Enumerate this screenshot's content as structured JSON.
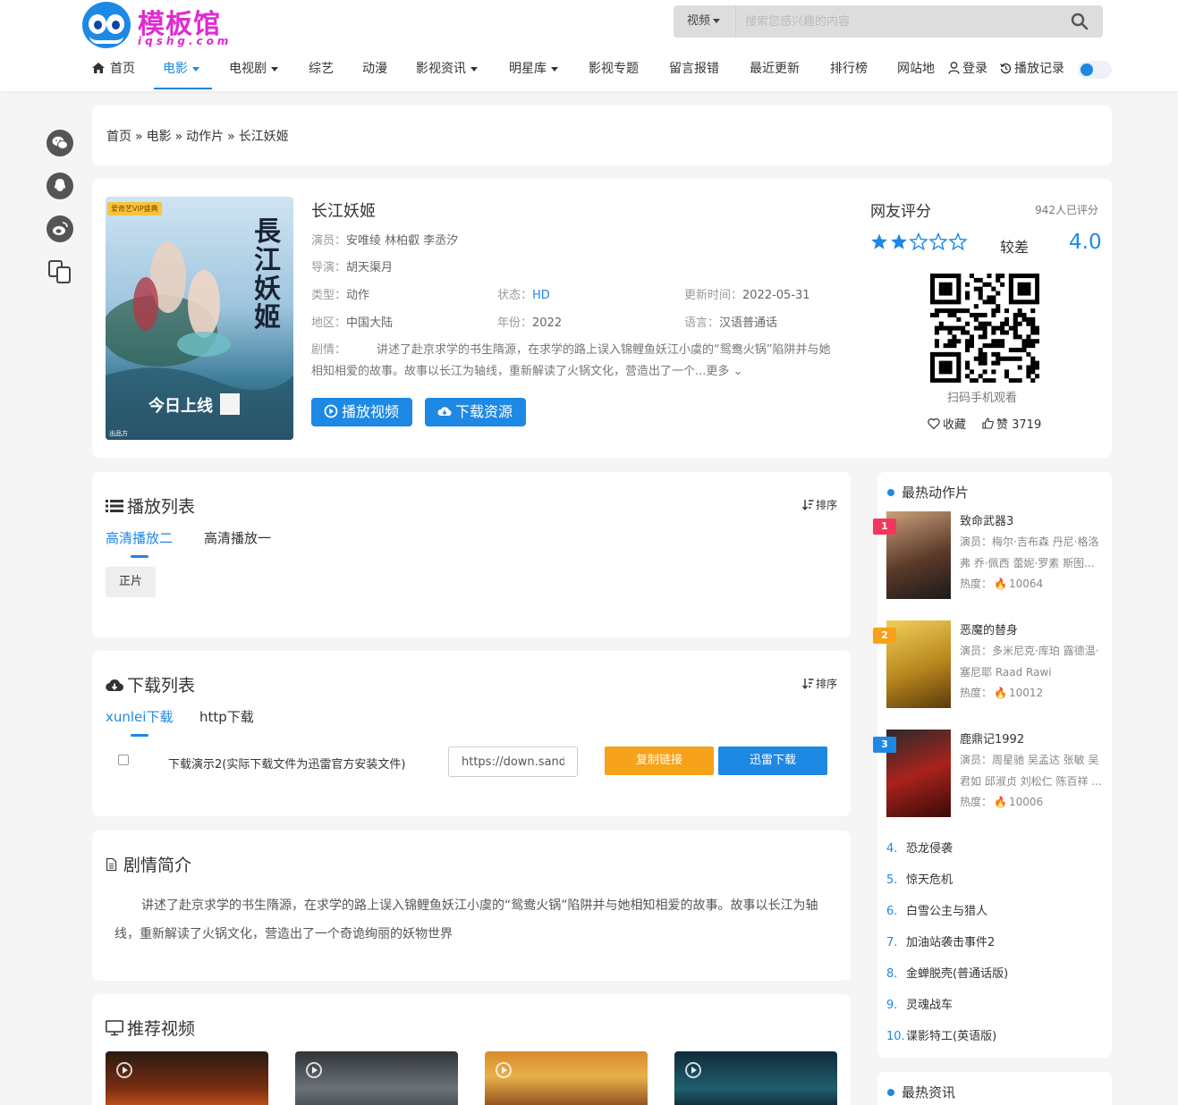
{
  "logo": {
    "text": "模板馆",
    "sub": "iqshg.com"
  },
  "search": {
    "type": "视频",
    "placeholder": "搜索您感兴趣的内容"
  },
  "nav": {
    "items": [
      {
        "label": "首页",
        "icon": "home-icon"
      },
      {
        "label": "电影",
        "active": true,
        "dropdown": true
      },
      {
        "label": "电视剧",
        "dropdown": true
      },
      {
        "label": "综艺"
      },
      {
        "label": "动漫"
      },
      {
        "label": "影视资讯",
        "dropdown": true
      },
      {
        "label": "明星库",
        "dropdown": true
      },
      {
        "label": "影视专题"
      },
      {
        "label": "留言报错"
      },
      {
        "label": "最近更新"
      },
      {
        "label": "排行榜"
      },
      {
        "label": "网站地图"
      }
    ],
    "login": "登录",
    "history": "播放记录"
  },
  "share": [
    "wechat-icon",
    "qq-icon",
    "weibo-icon",
    "copy-icon"
  ],
  "breadcrumb": {
    "home": "首页",
    "cat": "电影",
    "sub": "动作片",
    "current": "长江妖姬",
    "sep": "»"
  },
  "movie": {
    "title": "长江妖姬",
    "poster": {
      "tag": "爱奇艺VIP盛典",
      "title": "長江妖姬",
      "bottom": "今日上线",
      "foot": "出品方"
    },
    "actors_label": "演员：",
    "actors": "安唯绫 林柏叡 李丞汐",
    "director_label": "导演：",
    "director": "胡天渠月",
    "type_label": "类型：",
    "type": "动作",
    "status_label": "状态：",
    "status": "HD",
    "updated_label": "更新时间：",
    "updated": "2022-05-31",
    "area_label": "地区：",
    "area": "中国大陆",
    "year_label": "年份：",
    "year": "2022",
    "lang_label": "语言：",
    "lang": "汉语普通话",
    "plot_label": "剧情：",
    "plot_short": "讲述了赴京求学的书生隋源，在求学的路上误入锦鲤鱼妖江小虞的“鸳鸯火锅”陷阱并与她相知相爱的故事。故事以长江为轴线，重新解读了火锅文化，营造出了一个...",
    "more": "更多",
    "play_btn": "播放视频",
    "download_btn": "下载资源"
  },
  "rating": {
    "title": "网友评分",
    "count": "942人已评分",
    "stars_filled": 2,
    "stars_total": 5,
    "word": "较差",
    "score": "4.0",
    "qr_caption": "扫码手机观看",
    "fav": "收藏",
    "like": "赞 3719"
  },
  "playlist": {
    "title": "播放列表",
    "sort": "排序",
    "tabs": [
      "高清播放二",
      "高清播放一"
    ],
    "episodes": [
      "正片"
    ]
  },
  "download": {
    "title": "下载列表",
    "sort": "排序",
    "tabs": [
      "xunlei下载",
      "http下载"
    ],
    "item_name": "下载演示2(实际下载文件为迅雷官方安装文件)",
    "url": "https://down.sandai.net",
    "copy": "复制链接",
    "thunder": "迅雷下载"
  },
  "synopsis": {
    "title": "剧情简介",
    "text": "讲述了赴京求学的书生隋源，在求学的路上误入锦鲤鱼妖江小虞的“鸳鸯火锅”陷阱并与她相知相爱的故事。故事以长江为轴线，重新解读了火锅文化，营造出了一个奇诡绚丽的妖物世界"
  },
  "recommend": {
    "title": "推荐视频"
  },
  "hot": {
    "title": "最热动作片",
    "top": [
      {
        "rank": "1",
        "name": "致命武器3",
        "actors": "演员：梅尔·吉布森 丹尼·格洛弗 乔·佩西 蕾妮·罗素 斯图...",
        "heat_label": "热度：",
        "heat": "10064",
        "color": "#f5365c"
      },
      {
        "rank": "2",
        "name": "恶魔的替身",
        "actors": "演员：多米尼克·库珀 露德温·塞尼耶 Raad Rawi",
        "heat_label": "热度：",
        "heat": "10012",
        "color": "#f7a21b"
      },
      {
        "rank": "3",
        "name": "鹿鼎记1992",
        "actors": "演员：周星驰 吴孟达 张敏 吴君如 邱淑贞 刘松仁 陈百祥 ...",
        "heat_label": "热度：",
        "heat": "10006",
        "color": "#1e88e5"
      }
    ],
    "list": [
      {
        "idx": "4.",
        "name": "恐龙侵袭"
      },
      {
        "idx": "5.",
        "name": "惊天危机"
      },
      {
        "idx": "6.",
        "name": "白雪公主与猎人"
      },
      {
        "idx": "7.",
        "name": "加油站袭击事件2"
      },
      {
        "idx": "8.",
        "name": "金蝉脱壳(普通话版)"
      },
      {
        "idx": "9.",
        "name": "灵魂战车"
      },
      {
        "idx": "10.",
        "name": "谍影特工(英语版)"
      }
    ]
  },
  "news": {
    "title": "最热资讯"
  }
}
